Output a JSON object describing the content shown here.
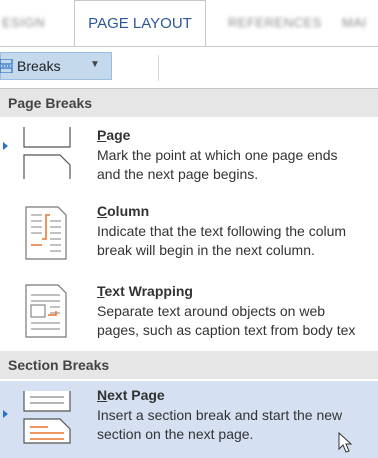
{
  "tabs": [
    {
      "label": "ESIGN",
      "active": false
    },
    {
      "label": "PAGE LAYOUT",
      "active": true
    },
    {
      "label": "REFERENCES",
      "active": false
    },
    {
      "label": "MAI",
      "active": false
    }
  ],
  "ribbon": {
    "breaks_label": "Breaks",
    "breaks_icon": "page-break-icon",
    "caret_icon": "caret-down-icon"
  },
  "menu": {
    "page_breaks_header": "Page Breaks",
    "section_breaks_header": "Section Breaks",
    "items": [
      {
        "key": "P",
        "rest": "age",
        "desc": "Mark the point at which one page ends\nand the next page begins.",
        "icon": "page-break-icon"
      },
      {
        "key": "C",
        "rest": "olumn",
        "desc": "Indicate that the text following the colum\nbreak will begin in the next column.",
        "icon": "column-break-icon"
      },
      {
        "key": "T",
        "rest": "ext Wrapping",
        "desc": "Separate text around objects on web\npages, such as caption text from body tex",
        "icon": "text-wrapping-icon"
      },
      {
        "key": "N",
        "rest": "ext Page",
        "desc": "Insert a section break and start the new\nsection on the next page.",
        "icon": "next-page-section-icon"
      }
    ]
  },
  "colors": {
    "accent": "#2b579a",
    "hover": "#d5e1f2",
    "header_bg": "#e6e6e6",
    "icon_orange": "#e8742a"
  }
}
